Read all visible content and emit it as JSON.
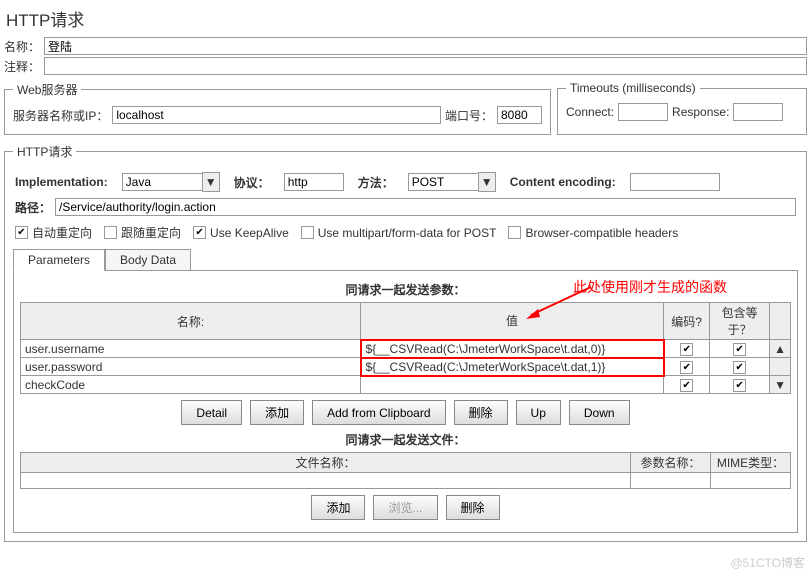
{
  "title": "HTTP请求",
  "name": {
    "label": "名称：",
    "value": "登陆"
  },
  "comment": {
    "label": "注释：",
    "value": ""
  },
  "webServer": {
    "legend": "Web服务器",
    "hostLabel": "服务器名称或IP：",
    "hostValue": "localhost",
    "portLabel": "端口号：",
    "portValue": "8080"
  },
  "timeouts": {
    "legend": "Timeouts (milliseconds)",
    "connectLabel": "Connect:",
    "connectValue": "",
    "responseLabel": "Response:",
    "responseValue": ""
  },
  "httpReq": {
    "legend": "HTTP请求",
    "implLabel": "Implementation:",
    "implValue": "Java",
    "protoLabel": "协议：",
    "protoValue": "http",
    "methodLabel": "方法：",
    "methodValue": "POST",
    "encLabel": "Content encoding:",
    "encValue": "",
    "pathLabel": "路径：",
    "pathValue": "/Service/authority/login.action",
    "checkboxes": [
      {
        "label": "自动重定向",
        "checked": true
      },
      {
        "label": "跟随重定向",
        "checked": false
      },
      {
        "label": "Use KeepAlive",
        "checked": true
      },
      {
        "label": "Use multipart/form-data for POST",
        "checked": false
      },
      {
        "label": "Browser-compatible headers",
        "checked": false
      }
    ],
    "tabs": {
      "params": "Parameters",
      "body": "Body Data"
    },
    "paramSection": "同请求一起发送参数：",
    "annotation": "此处使用刚才生成的函数",
    "headers": {
      "name": "名称:",
      "value": "值",
      "encode": "编码?",
      "include": "包含等于？"
    },
    "rows": [
      {
        "name": "user.username",
        "value": "${__CSVRead(C:\\JmeterWorkSpace\\t.dat,0)}",
        "encode": true,
        "include": true,
        "hl": true
      },
      {
        "name": "user.password",
        "value": "${__CSVRead(C:\\JmeterWorkSpace\\t.dat,1)}",
        "encode": true,
        "include": true,
        "hl": true
      },
      {
        "name": "checkCode",
        "value": "",
        "encode": true,
        "include": true,
        "hl": false
      }
    ],
    "buttons": {
      "detail": "Detail",
      "add": "添加",
      "clip": "Add from Clipboard",
      "del": "删除",
      "up": "Up",
      "down": "Down"
    },
    "fileSection": "同请求一起发送文件：",
    "fileHeaders": {
      "path": "文件名称：",
      "param": "参数名称：",
      "mime": "MIME类型："
    },
    "fileButtons": {
      "add": "添加",
      "browse": "浏览...",
      "del": "删除"
    }
  },
  "watermark": "@51CTO博客"
}
